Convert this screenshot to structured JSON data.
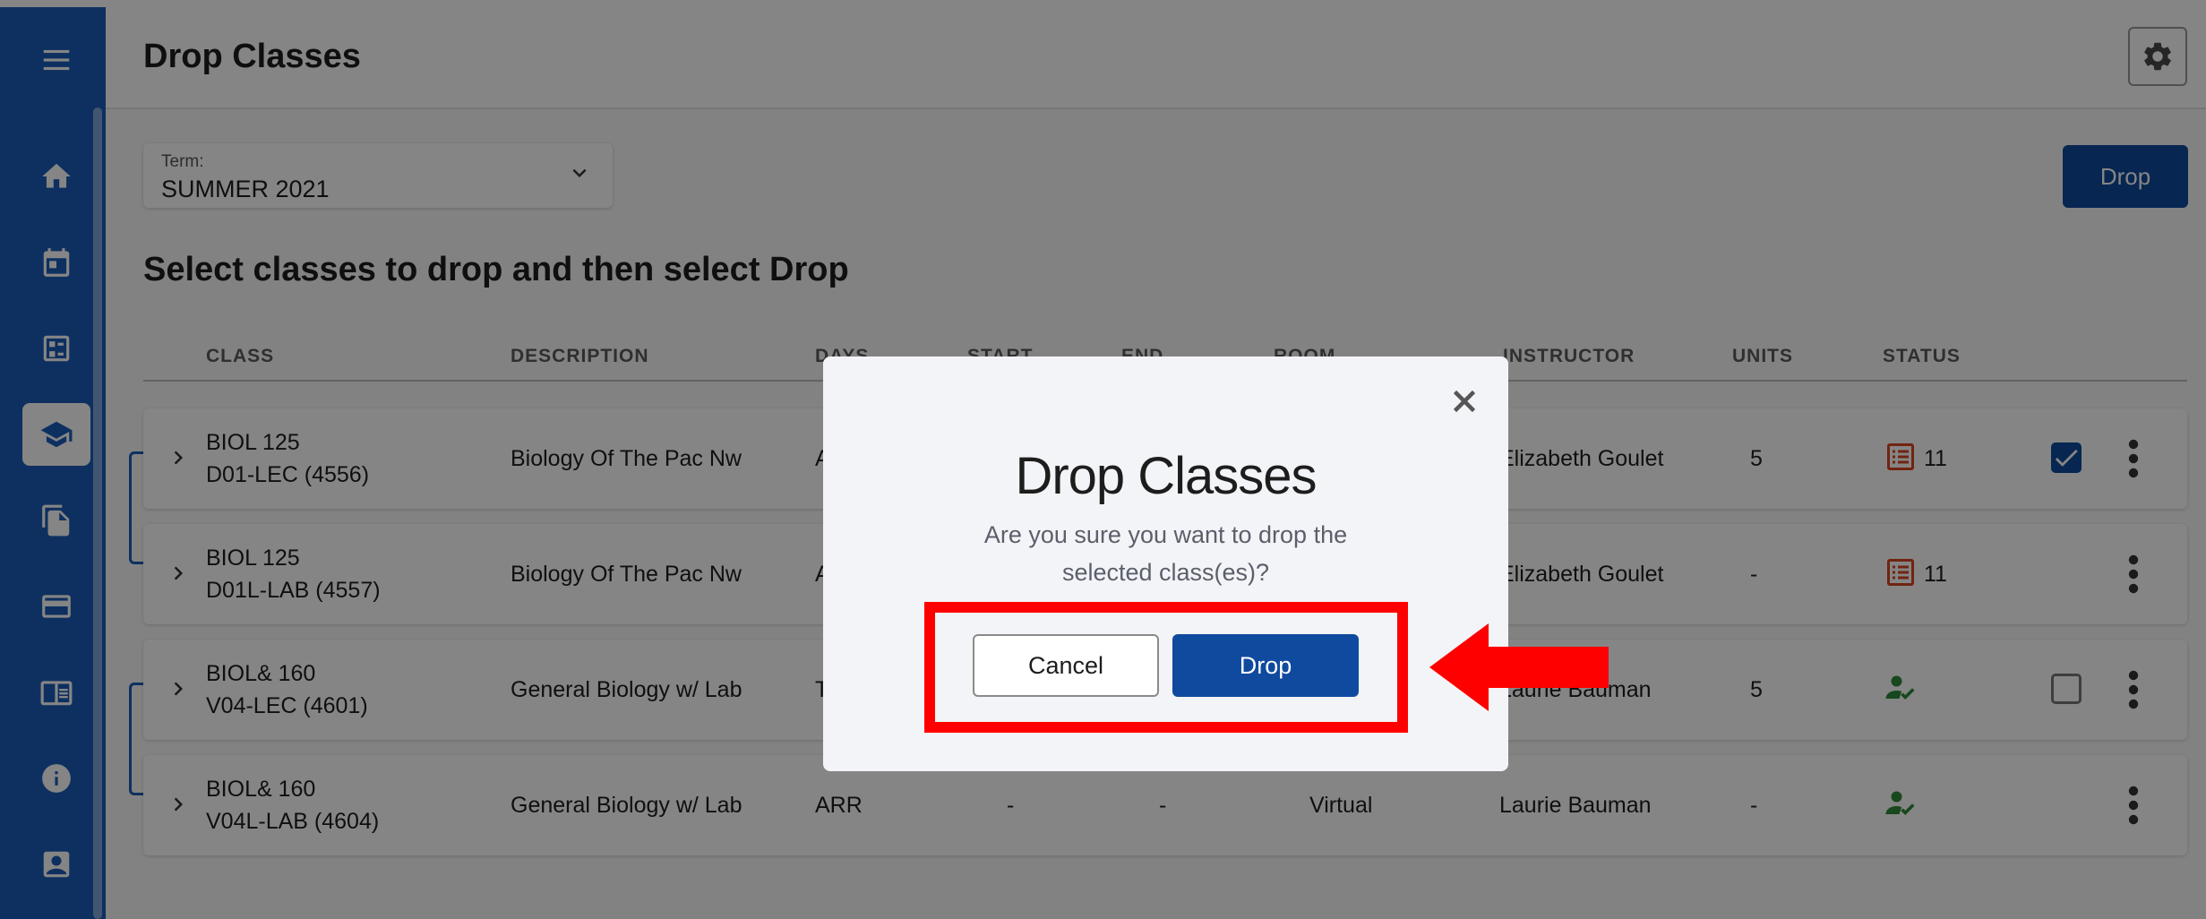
{
  "header": {
    "title": "Drop Classes",
    "settings_icon": "gear-icon"
  },
  "sidebar": {
    "menu_icon": "hamburger-menu-icon",
    "items": [
      {
        "icon": "home-icon"
      },
      {
        "icon": "calendar-icon"
      },
      {
        "icon": "checklist-icon"
      },
      {
        "icon": "graduation-cap-icon",
        "active": true
      },
      {
        "icon": "documents-icon"
      },
      {
        "icon": "credit-card-icon"
      },
      {
        "icon": "catalog-icon"
      },
      {
        "icon": "info-icon"
      },
      {
        "icon": "profile-icon"
      }
    ],
    "accent": "#1a5cb8"
  },
  "term": {
    "label": "Term:",
    "value": "SUMMER 2021"
  },
  "toolbar": {
    "drop_label": "Drop"
  },
  "main": {
    "subtitle": "Select classes to drop and then select Drop"
  },
  "table": {
    "headers": {
      "class": "CLASS",
      "description": "DESCRIPTION",
      "days": "DAYS",
      "start": "START",
      "end": "END",
      "room": "ROOM",
      "instructor": "INSTRUCTOR",
      "units": "UNITS",
      "status": "STATUS"
    },
    "rows": [
      {
        "class_line1": "BIOL 125",
        "class_line2": "D01-LEC (4556)",
        "description": "Biology Of The Pac Nw",
        "days": "A",
        "start": "",
        "end": "",
        "room": "",
        "instructor": "Elizabeth Goulet",
        "units": "5",
        "status_icon": "waitlist-icon",
        "status_count": "11",
        "checkbox": "checked"
      },
      {
        "class_line1": "BIOL 125",
        "class_line2": "D01L-LAB (4557)",
        "description": "Biology Of The Pac Nw",
        "days": "A",
        "start": "",
        "end": "",
        "room": "",
        "instructor": "Elizabeth Goulet",
        "units": "-",
        "status_icon": "waitlist-icon",
        "status_count": "11",
        "checkbox": "none"
      },
      {
        "class_line1": "BIOL& 160",
        "class_line2": "V04-LEC (4601)",
        "description": "General Biology w/ Lab",
        "days": "T",
        "start": "",
        "end": "",
        "room": "",
        "instructor": "Laurie Bauman",
        "units": "5",
        "status_icon": "enrolled-icon",
        "status_count": "",
        "checkbox": "unchecked"
      },
      {
        "class_line1": "BIOL& 160",
        "class_line2": "V04L-LAB (4604)",
        "description": "General Biology w/ Lab",
        "days": "ARR",
        "start": "-",
        "end": "-",
        "room": "Virtual",
        "instructor": "Laurie Bauman",
        "units": "-",
        "status_icon": "enrolled-icon",
        "status_count": "",
        "checkbox": "none"
      }
    ]
  },
  "modal": {
    "title": "Drop Classes",
    "message": "Are you sure you want to drop the selected class(es)?",
    "cancel_label": "Cancel",
    "confirm_label": "Drop",
    "close_icon": "close-icon"
  },
  "annotation": {
    "highlight_color": "#ff0000",
    "arrow_icon": "left-arrow-icon"
  }
}
